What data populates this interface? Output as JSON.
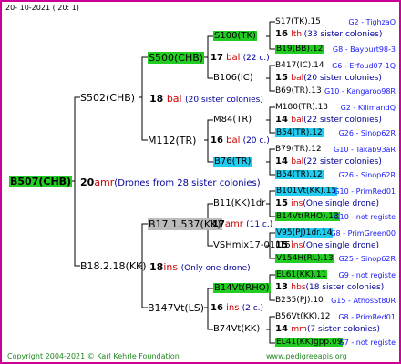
{
  "date": "20- 10-2021 ( 20: 1)",
  "gen1": {
    "name": "B507(CHB)",
    "year": "20",
    "breeder": "amr",
    "note": "(Drones from 28 sister colonies)"
  },
  "gen2a": {
    "name": "S502(CHB)",
    "year": "18",
    "breeder": "bal",
    "note": "(20 sister colonies)"
  },
  "gen2b": {
    "name": "B18.2.18(KK)",
    "year": "18",
    "breeder": "ins",
    "note": "(Only one drone)"
  },
  "gen3": [
    {
      "name": "S500(CHB)",
      "year": "17",
      "breeder": "bal",
      "note": "(22 c.)"
    },
    {
      "name": "M112(TR)",
      "year": "16",
      "breeder": "bal",
      "note": "(20 c.)"
    },
    {
      "name": "B17.1.537(KK)",
      "year": "17",
      "breeder": "amr",
      "note": "(11 c.)"
    },
    {
      "name": "B147Vt(LS)",
      "year": "16",
      "breeder": "ins",
      "note": "(2 c.)"
    }
  ],
  "gen4": [
    "S100(TK)",
    "B106(IC)",
    "M84(TR)",
    "B76(TR)",
    "B11(KK)1dr",
    "VSHmix17-01(15)",
    "B14Vt(RHO)",
    "B74Vt(KK)"
  ],
  "gen5": [
    {
      "text": "S17(TK).15",
      "right": "G2 - TighzaQ",
      "bg": ""
    },
    {
      "text": "16",
      "red": "lthl",
      "note": "(33 sister colonies)",
      "bg": ""
    },
    {
      "text": "B19(BB).12",
      "right": "G8 - Bayburt98-3",
      "bg": "g"
    },
    {
      "text": "B417(IC).14",
      "right": "G6 - Erfoud07-1Q",
      "bg": ""
    },
    {
      "text": "15",
      "red": "bal",
      "note": "(20 sister colonies)",
      "bg": ""
    },
    {
      "text": "B69(TR).13",
      "right": "G10 - Kangaroo98R",
      "bg": ""
    },
    {
      "text": "M180(TR).13",
      "right": "G2 - KilimandQ",
      "bg": ""
    },
    {
      "text": "14",
      "red": "bal",
      "note": "(22 sister colonies)",
      "bg": ""
    },
    {
      "text": "B54(TR).12",
      "right": "G26 - Sinop62R",
      "bg": "c"
    },
    {
      "text": "B79(TR).12",
      "right": "G10 - Takab93aR",
      "bg": ""
    },
    {
      "text": "14",
      "red": "bal",
      "note": "(22 sister colonies)",
      "bg": ""
    },
    {
      "text": "B54(TR).12",
      "right": "G26 - Sinop62R",
      "bg": "c"
    },
    {
      "text": "B101Vt(KK).15",
      "right": "G10 - PrimRed01",
      "bg": "c"
    },
    {
      "text": "15",
      "red": "ins",
      "note": "(One single drone)",
      "bg": ""
    },
    {
      "text": "B14Vt(RHO).13",
      "right": "G10 - not registe",
      "bg": "g"
    },
    {
      "text": "V95(PJ)1dr.14",
      "right": "G8 - PrimGreen00",
      "bg": "c"
    },
    {
      "text": "15",
      "red": "ins",
      "note": "(One single drone)",
      "bg": ""
    },
    {
      "text": "V154H(RL).13",
      "right": "G25 - Sinop62R",
      "bg": "g"
    },
    {
      "text": "EL61(KK).11",
      "right": "G9 - not registe",
      "bg": "g"
    },
    {
      "text": "13",
      "red": "hbs",
      "note": "(18 sister colonies)",
      "bg": ""
    },
    {
      "text": "B235(PJ).10",
      "right": "G15 - AthosSt80R",
      "bg": ""
    },
    {
      "text": "B56Vt(KK).12",
      "right": "G8 - PrimRed01",
      "bg": ""
    },
    {
      "text": "14",
      "red": "mm",
      "note": "(7 sister colonies)",
      "bg": ""
    },
    {
      "text": "EL41(KK)gpp.09",
      "right": "G7 - not registe",
      "bg": "g"
    }
  ],
  "footer": {
    "copyright": "Copyright 2004-2021 © Karl Kehrle Foundation",
    "site": "www.pedigreeapis.org"
  }
}
